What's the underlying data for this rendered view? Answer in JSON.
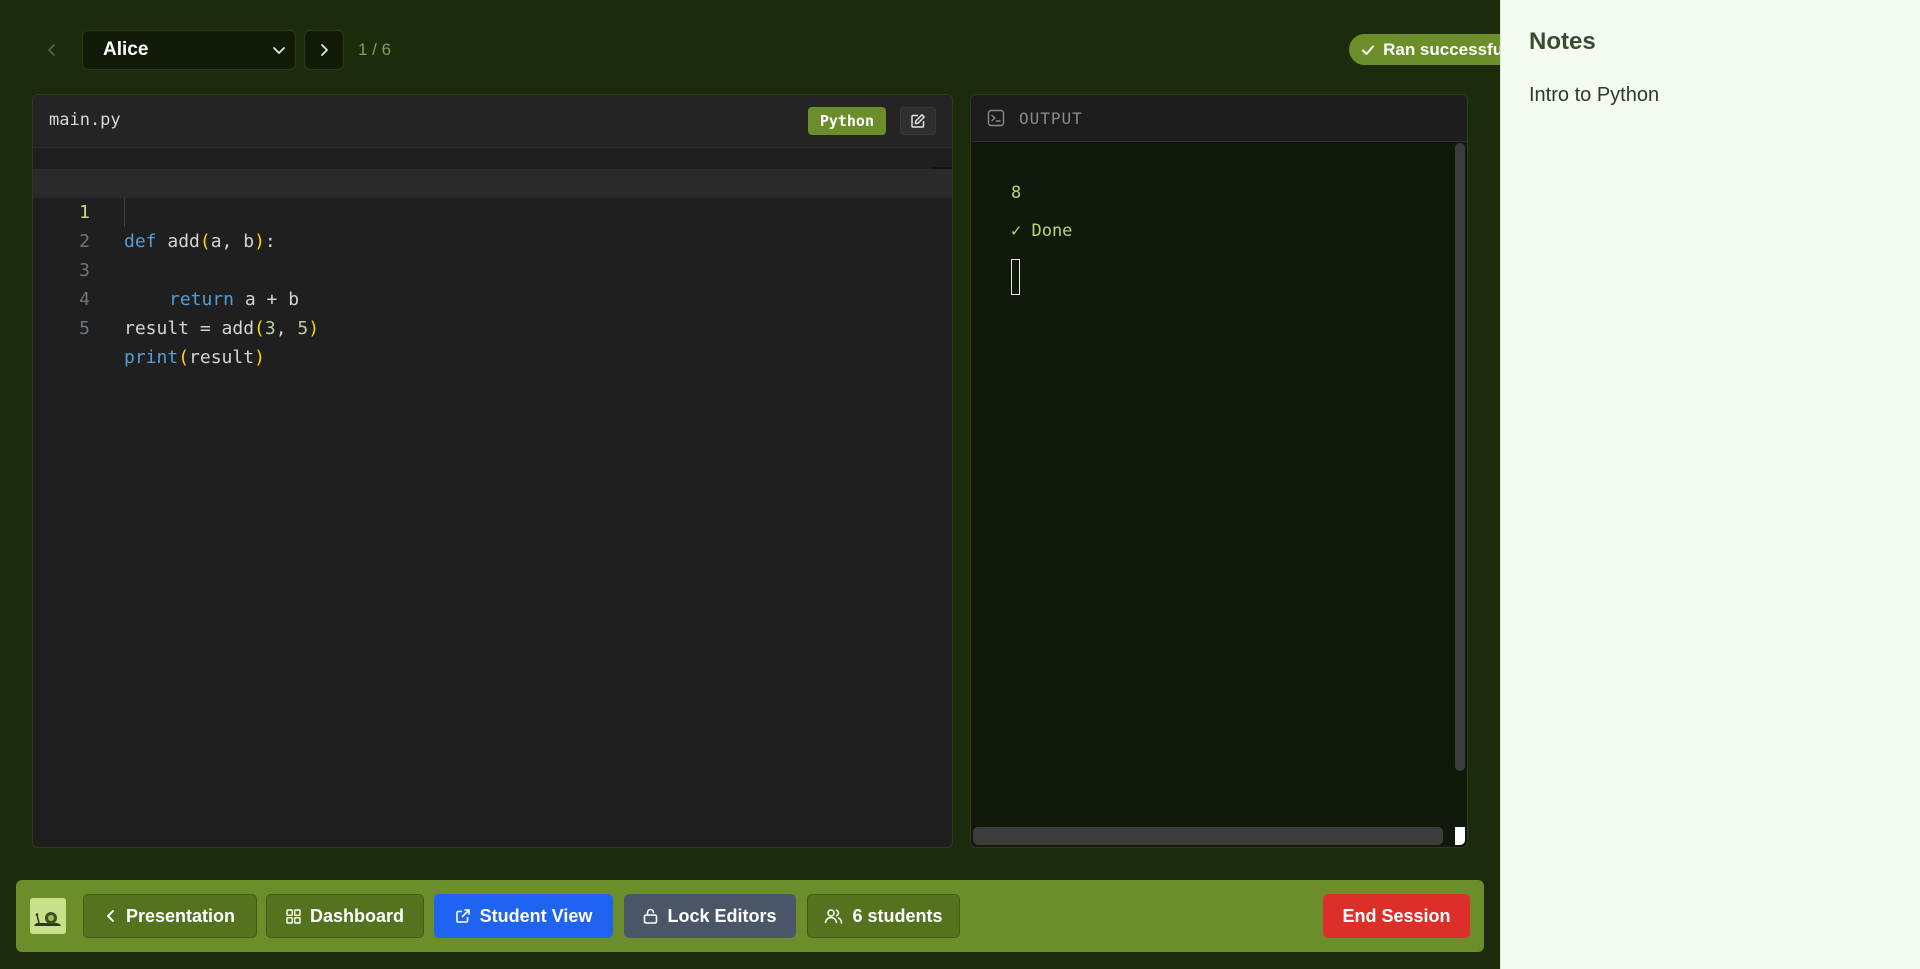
{
  "topbar": {
    "selected_student": "Alice",
    "position": "1 / 6",
    "status": "Ran successfully"
  },
  "editor": {
    "filename": "main.py",
    "language": "Python",
    "code": {
      "line_numbers": [
        "1",
        "2",
        "3",
        "4",
        "5"
      ],
      "l1": {
        "kw": "def",
        "name": " add",
        "open": "(",
        "args": "a, b",
        "close": ")",
        "end": ":"
      },
      "l2": {
        "kw": "return",
        "rest": " a + b"
      },
      "l4": {
        "lhs": "result = add",
        "open": "(",
        "a1": "3",
        "sep": ", ",
        "a2": "5",
        "close": ")"
      },
      "l5": {
        "fn": "print",
        "open": "(",
        "arg": "result",
        "close": ")"
      }
    }
  },
  "output": {
    "title": "OUTPUT",
    "lines": [
      "8",
      "✓ Done"
    ]
  },
  "toolbar": {
    "presentation_label": "Presentation",
    "dashboard_label": "Dashboard",
    "student_view_label": "Student View",
    "lock_label": "Lock Editors",
    "students_label": "6 students",
    "end_label": "End Session"
  },
  "notes": {
    "title": "Notes",
    "content": "Intro to Python"
  },
  "colors": {
    "page_bg": "#1b2b0b",
    "accent_green": "#6b8e2a",
    "primary_blue": "#1f64f0",
    "danger_red": "#dc2f2a",
    "notes_bg": "#f4fbf0"
  }
}
